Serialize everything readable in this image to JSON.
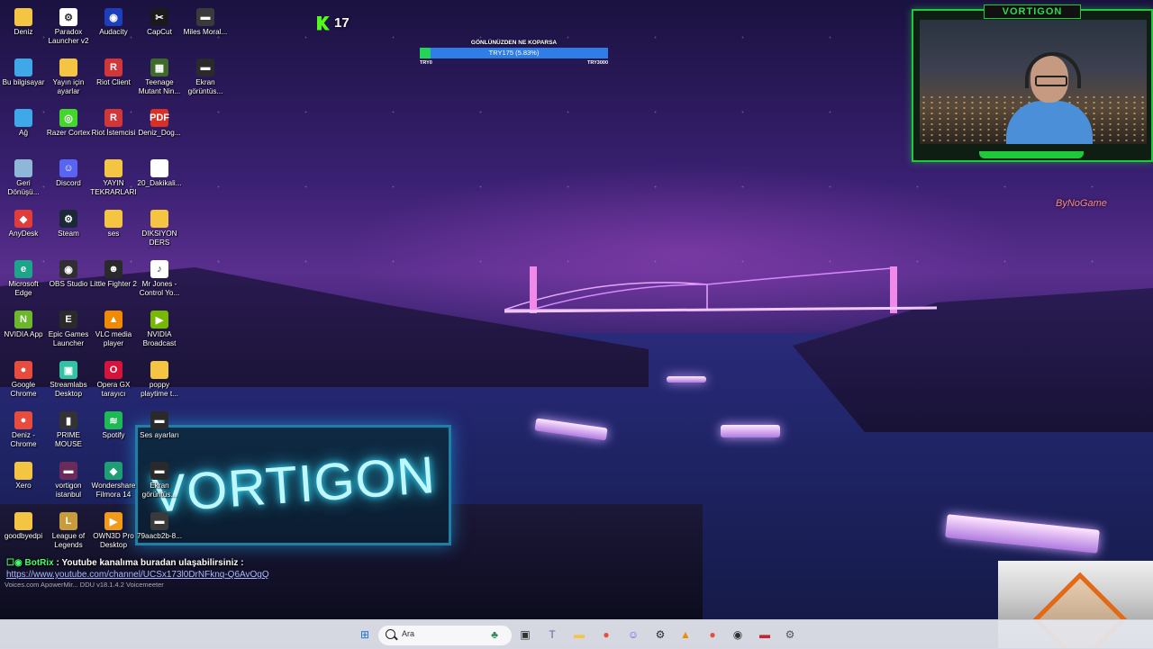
{
  "desktop": {
    "icons": [
      {
        "label": "Deniz",
        "glyph": "",
        "color": "#f4c542",
        "col": 0,
        "row": 0
      },
      {
        "label": "Bu bilgisayar",
        "glyph": "",
        "color": "#3ea8e8",
        "col": 0,
        "row": 1
      },
      {
        "label": "Ağ",
        "glyph": "",
        "color": "#3ea8e8",
        "col": 0,
        "row": 2
      },
      {
        "label": "Geri Dönüşü...",
        "glyph": "",
        "color": "#8fb8d8",
        "col": 0,
        "row": 3
      },
      {
        "label": "AnyDesk",
        "glyph": "◆",
        "color": "#e23b3b",
        "col": 0,
        "row": 4
      },
      {
        "label": "Microsoft Edge",
        "glyph": "e",
        "color": "#1ca58a",
        "col": 0,
        "row": 5
      },
      {
        "label": "NVIDIA App",
        "glyph": "N",
        "color": "#6bb82a",
        "col": 0,
        "row": 6
      },
      {
        "label": "Google Chrome",
        "glyph": "●",
        "color": "#e84c3d",
        "col": 0,
        "row": 7
      },
      {
        "label": "Deniz - Chrome",
        "glyph": "●",
        "color": "#e84c3d",
        "col": 0,
        "row": 8
      },
      {
        "label": "Xero",
        "glyph": "",
        "color": "#f4c542",
        "col": 0,
        "row": 9
      },
      {
        "label": "goodbyedpi",
        "glyph": "",
        "color": "#f4c542",
        "col": 0,
        "row": 10
      },
      {
        "label": "Paradox Launcher v2",
        "glyph": "⚙",
        "color": "#ffffff",
        "col": 1,
        "row": 0
      },
      {
        "label": "Yayın için ayarlar",
        "glyph": "",
        "color": "#f4c542",
        "col": 1,
        "row": 1
      },
      {
        "label": "Razer Cortex",
        "glyph": "◎",
        "color": "#44d62c",
        "col": 1,
        "row": 2
      },
      {
        "label": "Discord",
        "glyph": "☺",
        "color": "#5865f2",
        "col": 1,
        "row": 3
      },
      {
        "label": "Steam",
        "glyph": "⚙",
        "color": "#1b2838",
        "col": 1,
        "row": 4
      },
      {
        "label": "OBS Studio",
        "glyph": "◉",
        "color": "#302e31",
        "col": 1,
        "row": 5
      },
      {
        "label": "Epic Games Launcher",
        "glyph": "E",
        "color": "#2a2a2a",
        "col": 1,
        "row": 6
      },
      {
        "label": "Streamlabs Desktop",
        "glyph": "▣",
        "color": "#31c3a2",
        "col": 1,
        "row": 7
      },
      {
        "label": "PRIME MOUSE",
        "glyph": "▮",
        "color": "#333333",
        "col": 1,
        "row": 8
      },
      {
        "label": "vortigon istanbul",
        "glyph": "▬",
        "color": "#6a2a5a",
        "col": 1,
        "row": 9
      },
      {
        "label": "League of Legends",
        "glyph": "L",
        "color": "#c89b3c",
        "col": 1,
        "row": 10
      },
      {
        "label": "Audacity",
        "glyph": "◉",
        "color": "#1d3fbb",
        "col": 2,
        "row": 0
      },
      {
        "label": "Riot Client",
        "glyph": "R",
        "color": "#d13639",
        "col": 2,
        "row": 1
      },
      {
        "label": "Riot İstemcisi",
        "glyph": "R",
        "color": "#d13639",
        "col": 2,
        "row": 2
      },
      {
        "label": "YAYIN TEKRARLARI",
        "glyph": "",
        "color": "#f4c542",
        "col": 2,
        "row": 3
      },
      {
        "label": "ses",
        "glyph": "",
        "color": "#f4c542",
        "col": 2,
        "row": 4
      },
      {
        "label": "Little Fighter 2",
        "glyph": "☻",
        "color": "#2a2a2a",
        "col": 2,
        "row": 5
      },
      {
        "label": "VLC media player",
        "glyph": "▲",
        "color": "#f08a00",
        "col": 2,
        "row": 6
      },
      {
        "label": "Opera GX tarayıcı",
        "glyph": "O",
        "color": "#d6133a",
        "col": 2,
        "row": 7
      },
      {
        "label": "Spotify",
        "glyph": "≋",
        "color": "#1db954",
        "col": 2,
        "row": 8
      },
      {
        "label": "Wondershare Filmora 14",
        "glyph": "◆",
        "color": "#1d9f73",
        "col": 2,
        "row": 9
      },
      {
        "label": "OWN3D Pro Desktop",
        "glyph": "▶",
        "color": "#f29a1a",
        "col": 2,
        "row": 10
      },
      {
        "label": "CapCut",
        "glyph": "✂",
        "color": "#1a1a1a",
        "col": 3,
        "row": 0
      },
      {
        "label": "Teenage Mutant Nin...",
        "glyph": "▦",
        "color": "#3f6a2a",
        "col": 3,
        "row": 1
      },
      {
        "label": "Deniz_Dog...",
        "glyph": "PDF",
        "color": "#d93025",
        "col": 3,
        "row": 2
      },
      {
        "label": "20_Dakikali...",
        "glyph": "",
        "color": "#ffffff",
        "col": 3,
        "row": 3
      },
      {
        "label": "DIKSIYON DERS ANLA...",
        "glyph": "",
        "color": "#f4c542",
        "col": 3,
        "row": 4
      },
      {
        "label": "Mr Jones - Control Yo...",
        "glyph": "♪",
        "color": "#ffffff",
        "col": 3,
        "row": 5
      },
      {
        "label": "NVIDIA Broadcast",
        "glyph": "▶",
        "color": "#76b900",
        "col": 3,
        "row": 6
      },
      {
        "label": "poppy playtime t...",
        "glyph": "",
        "color": "#f4c542",
        "col": 3,
        "row": 7
      },
      {
        "label": "Ses ayarları",
        "glyph": "▬",
        "color": "#2a2a2a",
        "col": 3,
        "row": 8
      },
      {
        "label": "Ekran görüntüs...",
        "glyph": "▬",
        "color": "#2a2a2a",
        "col": 3,
        "row": 9
      },
      {
        "label": "79aacb2b-8...",
        "glyph": "▬",
        "color": "#3a3a3a",
        "col": 3,
        "row": 10
      },
      {
        "label": "Miles Moral...",
        "glyph": "▬",
        "color": "#3a3a3a",
        "col": 4,
        "row": 0
      },
      {
        "label": "Ekran görüntüs...",
        "glyph": "▬",
        "color": "#2a2a2a",
        "col": 4,
        "row": 1
      }
    ]
  },
  "kick": {
    "count": "17"
  },
  "goal": {
    "title": "GÖNLÜNÜZDEN NE KOPARSA",
    "value_text": "TRY175 (5.83%)",
    "progress_fraction": 0.0583,
    "min": "TRY0",
    "max": "TRY3000"
  },
  "webcam": {
    "title": "VORTIGON"
  },
  "sign": {
    "text": "VORTIGON"
  },
  "brand": {
    "text": "ByNoGame"
  },
  "chat": {
    "user": "BotRix",
    "message": "Youtube kanalıma buradan ulaşabilirsiniz :",
    "link": "https://www.youtube.com/channel/UCSx173l0DrNFknq-Q6AvOgQ",
    "underlay": "Voices.com   ApowerMir...  DDU v18.1.4.2   Voicemeeter"
  },
  "taskbar": {
    "search_placeholder": "Ara",
    "items": [
      {
        "name": "windows-start-icon",
        "glyph": "⊞",
        "color": "#1f6fd6"
      },
      {
        "name": "widgets-icon",
        "glyph": "♣",
        "color": "#2e8b57"
      },
      {
        "name": "task-view-icon",
        "glyph": "▣",
        "color": "#333333"
      },
      {
        "name": "teams-icon",
        "glyph": "T",
        "color": "#6264a7"
      },
      {
        "name": "file-explorer-icon",
        "glyph": "▬",
        "color": "#f4c542"
      },
      {
        "name": "chrome-icon",
        "glyph": "●",
        "color": "#e84c3d"
      },
      {
        "name": "discord-icon",
        "glyph": "☺",
        "color": "#5865f2"
      },
      {
        "name": "steam-icon",
        "glyph": "⚙",
        "color": "#1b2838"
      },
      {
        "name": "vlc-icon",
        "glyph": "▲",
        "color": "#f08a00"
      },
      {
        "name": "chrome-profile-icon",
        "glyph": "●",
        "color": "#e84c3d"
      },
      {
        "name": "obs-icon",
        "glyph": "◉",
        "color": "#302e31"
      },
      {
        "name": "voicemeeter-icon",
        "glyph": "▬",
        "color": "#c0282d"
      },
      {
        "name": "settings-icon",
        "glyph": "⚙",
        "color": "#555555"
      }
    ]
  }
}
